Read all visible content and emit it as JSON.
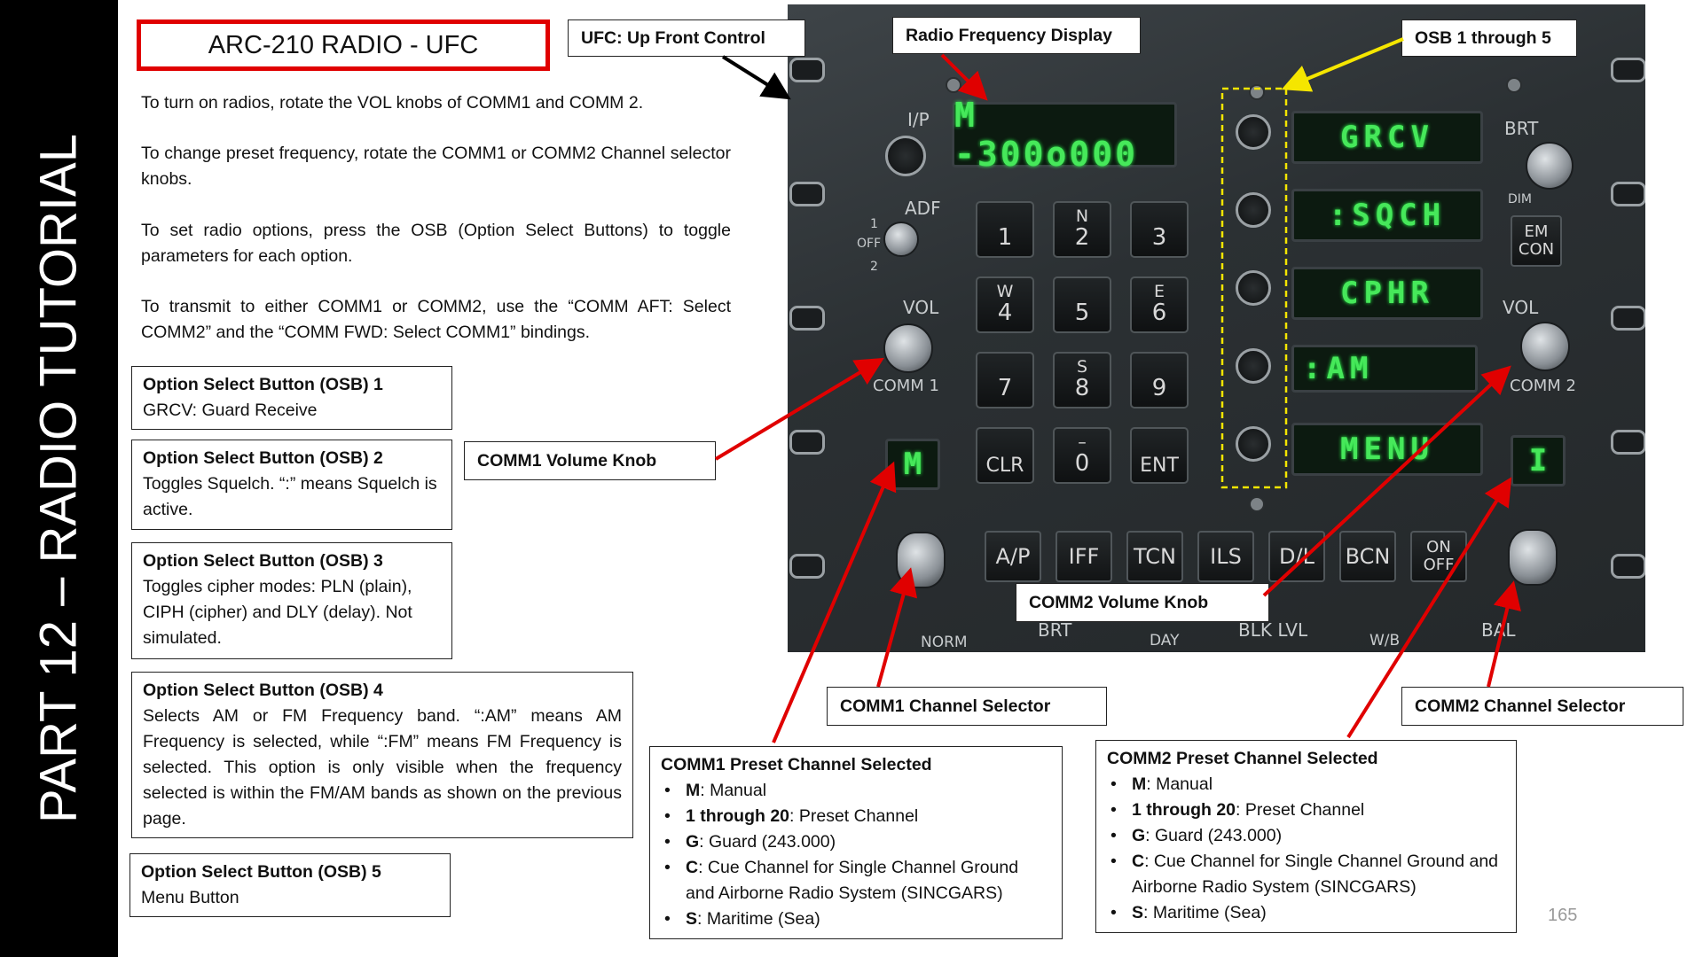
{
  "sidebar": {
    "title": "PART 12 – RADIO TUTORIAL"
  },
  "heading": "ARC-210 RADIO - UFC",
  "paragraphs": [
    "To turn on radios, rotate the VOL knobs of COMM1 and COMM 2.",
    "To change preset frequency, rotate the COMM1 or COMM2 Channel selector knobs.",
    "To set radio options, press the OSB (Option Select Buttons) to toggle parameters for each option.",
    "To transmit to either COMM1 or COMM2, use the “COMM AFT: Select COMM2” and the “COMM FWD: Select COMM1” bindings."
  ],
  "osb_boxes": [
    {
      "title": "Option Select Button (OSB) 1",
      "text": "GRCV: Guard Receive"
    },
    {
      "title": "Option Select Button (OSB) 2",
      "text": "Toggles Squelch. “:” means Squelch is active."
    },
    {
      "title": "Option Select Button (OSB) 3",
      "text": "Toggles cipher modes: PLN (plain), CIPH (cipher) and DLY (delay). Not simulated."
    },
    {
      "title": "Option Select Button (OSB) 4",
      "text": "Selects AM or FM Frequency band. “:AM” means AM Frequency is selected, while “:FM” means FM Frequency is selected. This option is only visible when the frequency selected is within the FM/AM bands as shown on the previous page."
    },
    {
      "title": "Option Select Button (OSB) 5",
      "text": "Menu Button"
    }
  ],
  "callouts": {
    "ufc": "UFC: Up Front Control",
    "freq_display": "Radio Frequency Display",
    "osb_range": "OSB 1 through 5",
    "comm1_vol": "COMM1 Volume Knob",
    "comm2_vol": "COMM2 Volume Knob",
    "comm1_chan": "COMM1 Channel Selector",
    "comm2_chan": "COMM2 Channel Selector"
  },
  "preset_boxes": [
    {
      "title": "COMM1 Preset Channel Selected",
      "items": [
        {
          "key": "M",
          "desc": ": Manual"
        },
        {
          "key": "1 through 20",
          "desc": ": Preset Channel"
        },
        {
          "key": "G",
          "desc": ": Guard (243.000)"
        },
        {
          "key": "C",
          "desc": ": Cue Channel for Single Channel Ground and Airborne Radio System (SINCGARS)"
        },
        {
          "key": "S",
          "desc": ": Maritime (Sea)"
        }
      ]
    },
    {
      "title": "COMM2 Preset Channel Selected",
      "items": [
        {
          "key": "M",
          "desc": ": Manual"
        },
        {
          "key": "1 through 20",
          "desc": ": Preset Channel"
        },
        {
          "key": "G",
          "desc": ": Guard (243.000)"
        },
        {
          "key": "C",
          "desc": ": Cue Channel for Single Channel Ground and Airborne Radio System (SINCGARS)"
        },
        {
          "key": "S",
          "desc": ": Maritime (Sea)"
        }
      ]
    }
  ],
  "ufc_panel": {
    "scratchpad": "M -300o000",
    "comm1_display": "M",
    "comm2_display": "I",
    "option_displays": [
      "GRCV",
      ":SQCH",
      "CPHR",
      ":AM",
      "MENU"
    ],
    "keypad": [
      {
        "main": "1",
        "sup": ""
      },
      {
        "main": "2",
        "sup": "N"
      },
      {
        "main": "3",
        "sup": ""
      },
      {
        "main": "4",
        "sup": "W"
      },
      {
        "main": "5",
        "sup": ""
      },
      {
        "main": "6",
        "sup": "E"
      },
      {
        "main": "7",
        "sup": ""
      },
      {
        "main": "8",
        "sup": "S"
      },
      {
        "main": "9",
        "sup": ""
      },
      {
        "main": "CLR",
        "sup": ""
      },
      {
        "main": "0",
        "sup": "–"
      },
      {
        "main": "ENT",
        "sup": ""
      }
    ],
    "bottom_buttons": [
      "A/P",
      "IFF",
      "TCN",
      "ILS",
      "D/L",
      "BCN",
      "ON OFF"
    ],
    "labels": {
      "ip": "I/P",
      "adf": "ADF",
      "off": "OFF",
      "one": "1",
      "two": "2",
      "vol_left": "VOL",
      "vol_right": "VOL",
      "comm1": "COMM 1",
      "comm2": "COMM 2",
      "brt_top": "BRT",
      "dim": "DIM",
      "emcon": "EM CON",
      "norm": "NORM",
      "brt_bottom": "BRT",
      "day": "DAY",
      "blk_lvl": "BLK LVL",
      "wb": "W/B",
      "bal": "BAL"
    }
  },
  "page_number": "165",
  "colors": {
    "accent_red": "#e00000",
    "osb_yellow": "#f5e600",
    "display_green": "#46e85a"
  }
}
